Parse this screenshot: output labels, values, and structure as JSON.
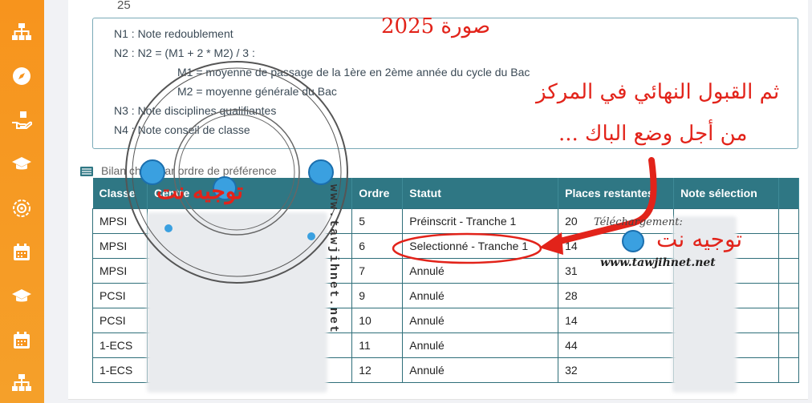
{
  "top_value": "25",
  "notes": {
    "n1": "N1 : Note redoublement",
    "n2": "N2 : N2 = (M1 + 2 * M2) / 3 :",
    "m1": "M1 = moyenne de passage de la 1ère en 2ème année du cycle du Bac",
    "m2": "M2 = moyenne générale du Bac",
    "n3": "N3 : Note disciplines qualifiantes",
    "n4": "N4 : Note conseil de classe"
  },
  "section": {
    "title": "Bilan choix par ordre de préférence"
  },
  "table": {
    "headers": [
      "Classe",
      "Centre",
      "Ordre",
      "Statut",
      "Places restantes",
      "Note sélection"
    ],
    "rows": [
      {
        "classe": "MPSI",
        "ordre": "5",
        "statut": "Préinscrit - Tranche 1",
        "places": "20"
      },
      {
        "classe": "MPSI",
        "ordre": "6",
        "statut": "Selectionné - Tranche 1",
        "places": "14"
      },
      {
        "classe": "MPSI",
        "ordre": "7",
        "statut": "Annulé",
        "places": "31"
      },
      {
        "classe": "PCSI",
        "ordre": "9",
        "statut": "Annulé",
        "places": "28"
      },
      {
        "classe": "PCSI",
        "ordre": "10",
        "statut": "Annulé",
        "places": "14"
      },
      {
        "classe": "1-ECS",
        "ordre": "11",
        "statut": "Annulé",
        "places": "44"
      },
      {
        "classe": "1-ECS",
        "ordre": "12",
        "statut": "Annulé",
        "places": "32"
      }
    ]
  },
  "overlay": {
    "photo_label": "صورة 2025",
    "arabic_line1": "ثم القبول النهائي في المركز",
    "arabic_line2": "من أجل وضع الباك ...",
    "brand_ar": "توجيه نت",
    "telechargement": "Téléchargement:",
    "website": "www.tawjihnet.net",
    "stamp_text": "www.tawjihnet.net"
  },
  "colors": {
    "sidebar": "#f7941d",
    "table_header": "#2f7784",
    "annotation": "#e2231a"
  }
}
